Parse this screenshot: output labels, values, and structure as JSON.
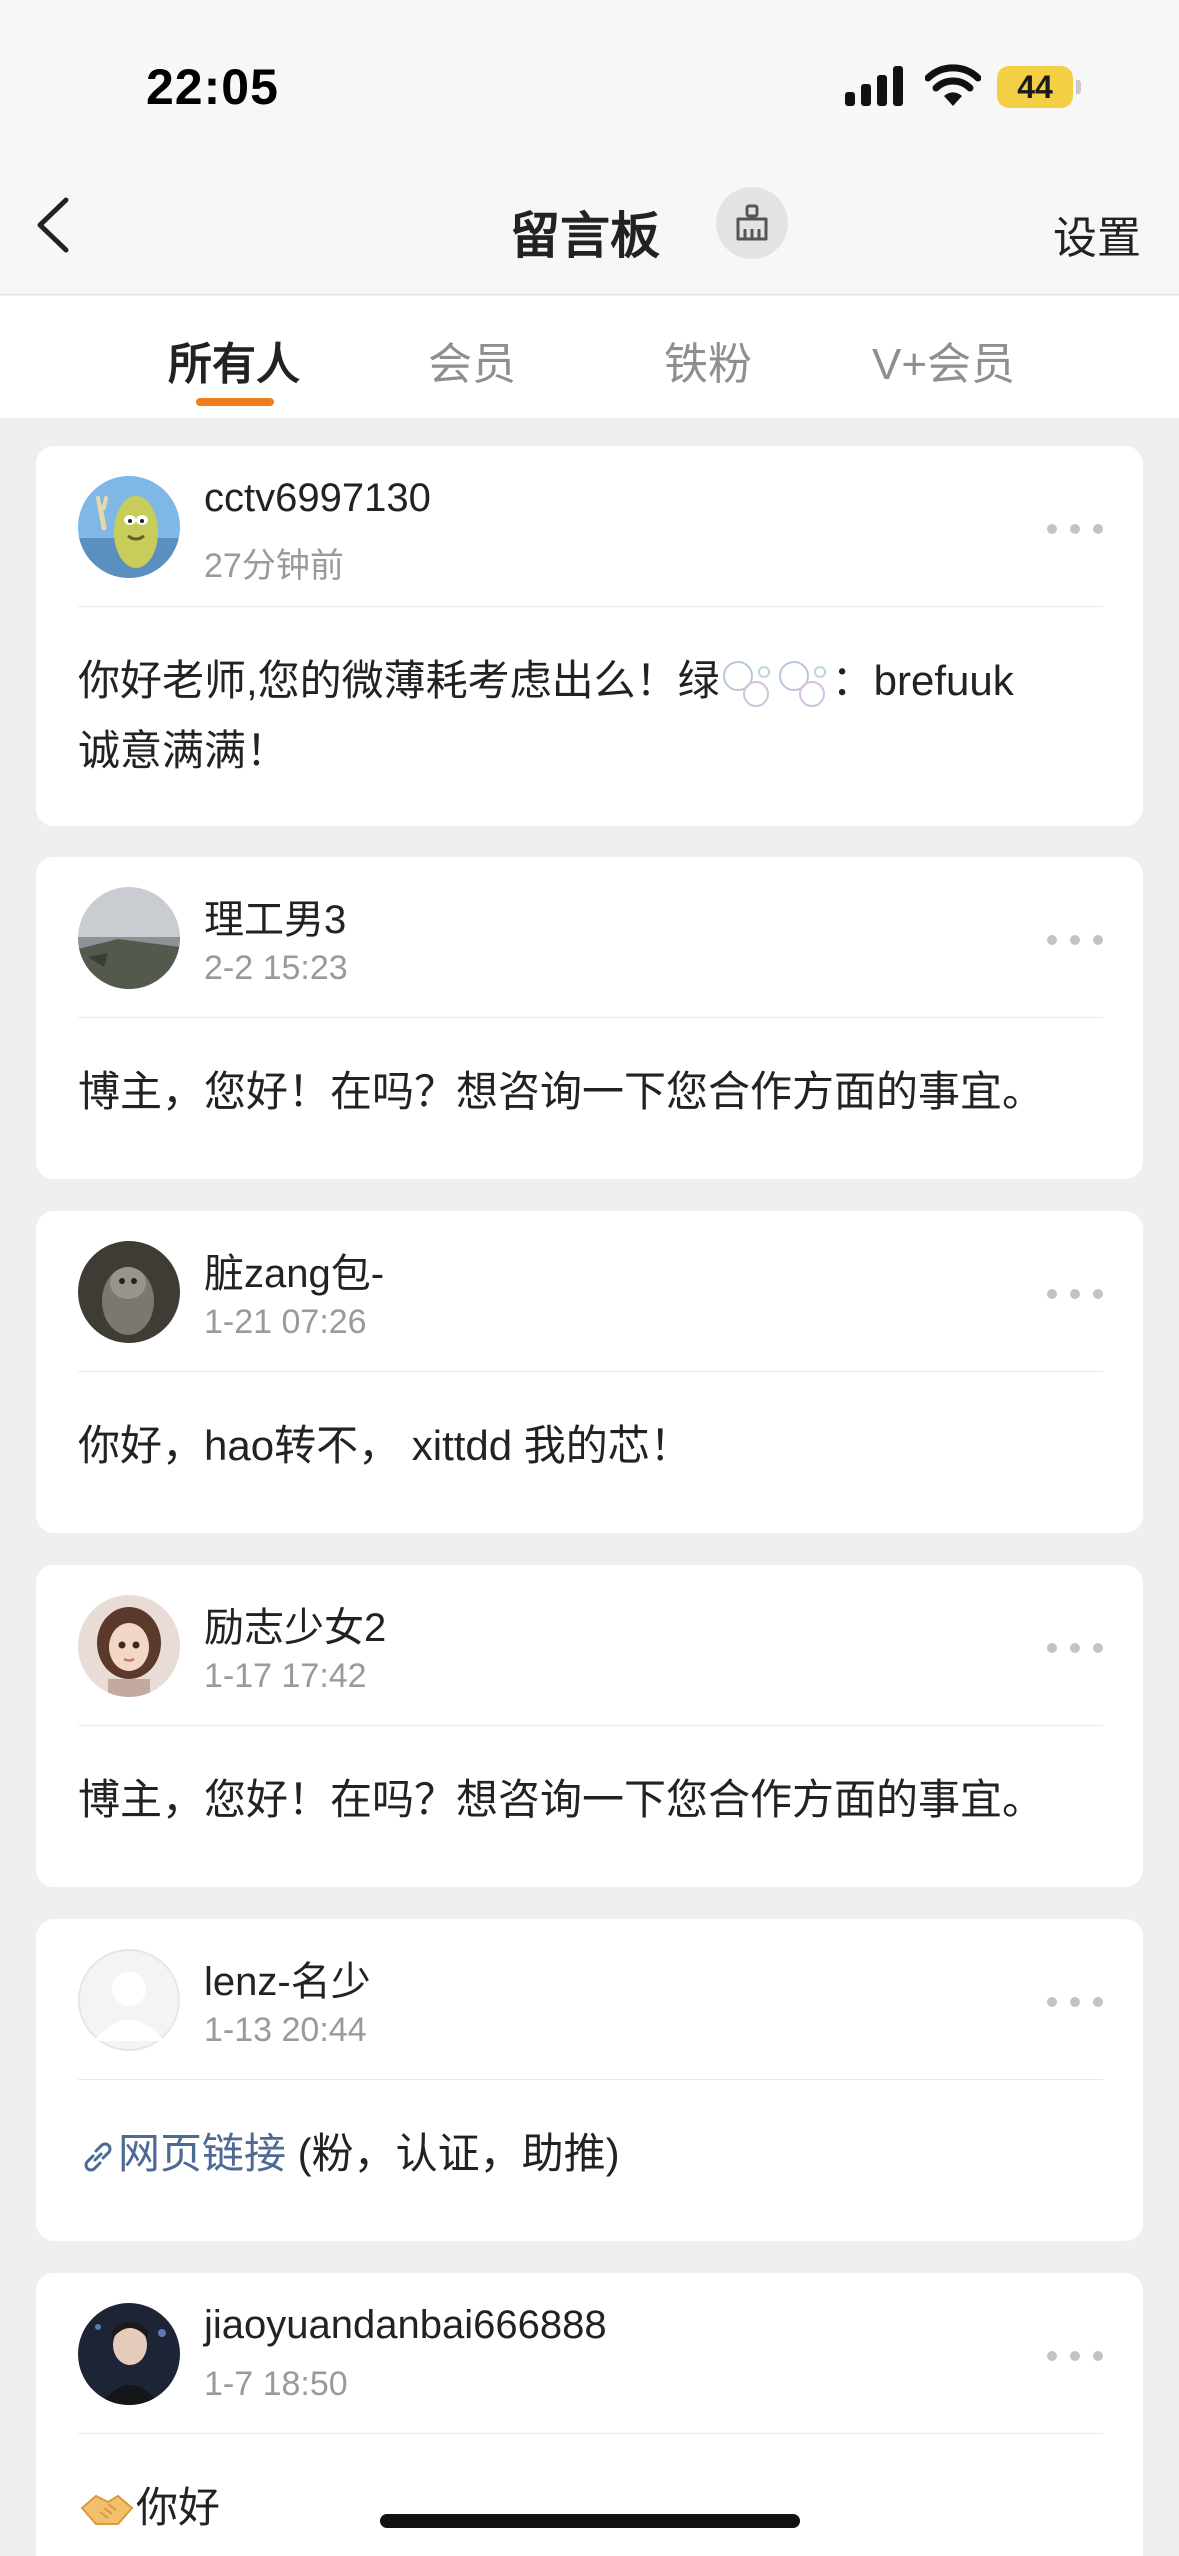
{
  "status_bar": {
    "time": "22:05",
    "battery": "44",
    "battery_color": "#f2cf45"
  },
  "nav": {
    "title": "留言板",
    "settings_label": "设置",
    "back_icon": "chevron-left-icon",
    "clear_icon": "broom-icon"
  },
  "tabs": [
    {
      "label": "所有人",
      "active": true
    },
    {
      "label": "会员",
      "active": false
    },
    {
      "label": "铁粉",
      "active": false
    },
    {
      "label": "V+会员",
      "active": false
    }
  ],
  "accent_color": "#ef7d1b",
  "messages": [
    {
      "username": "cctv6997130",
      "time": "27分钟前",
      "text_1": "你好老师,您的微薄耗考虑出么！绿",
      "text_2": "：brefuuk",
      "text_3": "诚意满满！"
    },
    {
      "username": "理工男3",
      "time": "2-2 15:23",
      "text": "博主，您好！在吗？想咨询一下您合作方面的事宜。"
    },
    {
      "username": "脏zang包-",
      "time": "1-21 07:26",
      "text": "你好，hao转不， xittdd  我的芯！"
    },
    {
      "username": "励志少女2",
      "time": "1-17 17:42",
      "text": "博主，您好！在吗？想咨询一下您合作方面的事宜。"
    },
    {
      "username": "lenz-名少",
      "time": "1-13 20:44",
      "link_text": "网页链接",
      "text": " (粉，认证，助推)"
    },
    {
      "username": "jiaoyuandanbai666888",
      "time": "1-7 18:50",
      "text": "你好"
    }
  ]
}
